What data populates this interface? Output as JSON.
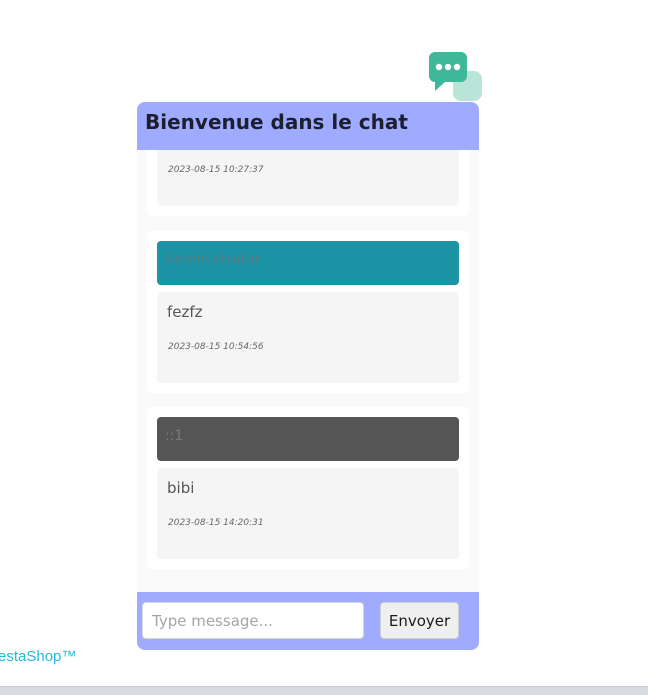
{
  "footer": {
    "brand_text": "estaShop™"
  },
  "chat": {
    "title": "Bienvenue dans le chat",
    "icon": "chat-bubbles-icon",
    "messages": [
      {
        "author": "",
        "text": "",
        "time": "2023-08-15 10:27:37"
      },
      {
        "author": "Administrator",
        "text": "fezfz",
        "time": "2023-08-15 10:54:56",
        "author_color": "#1d93a6"
      },
      {
        "author": "::1",
        "text": "bibi",
        "time": "2023-08-15 14:20:31",
        "author_color": "#555555"
      }
    ],
    "input": {
      "value": "",
      "placeholder": "Type message..."
    },
    "send_label": "Envoyer"
  },
  "colors": {
    "header_footer": "#9fabff",
    "admin_badge": "#1d93a6",
    "guest_badge": "#555555",
    "icon_primary": "#3fb89a",
    "icon_secondary": "#b9e4d8",
    "brand_link": "#25b9d7"
  }
}
